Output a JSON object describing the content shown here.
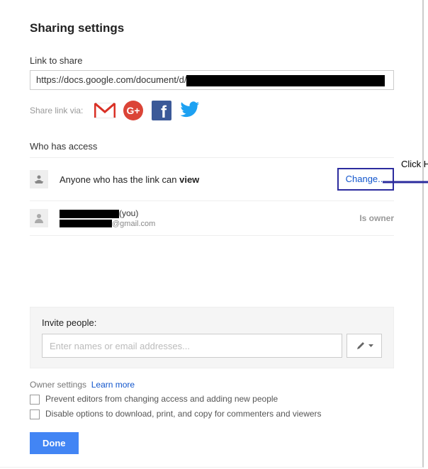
{
  "title": "Sharing settings",
  "link": {
    "label": "Link to share",
    "value_visible": "https://docs.google.com/document/d/"
  },
  "share_via": {
    "label": "Share link via:",
    "services": [
      "gmail",
      "google-plus",
      "facebook",
      "twitter"
    ]
  },
  "access": {
    "label": "Who has access",
    "anyone_prefix": "Anyone who has the link can ",
    "anyone_perm": "view",
    "change": "Change...",
    "you_suffix": "(you)",
    "email_suffix": "@gmail.com",
    "owner": "Is owner"
  },
  "annotation": {
    "text": "Click Here"
  },
  "invite": {
    "label": "Invite people:",
    "placeholder": "Enter names or email addresses..."
  },
  "owner_settings": {
    "label": "Owner settings",
    "learn_more": "Learn more",
    "cb1": "Prevent editors from changing access and adding new people",
    "cb2": "Disable options to download, print, and copy for commenters and viewers"
  },
  "done": "Done"
}
